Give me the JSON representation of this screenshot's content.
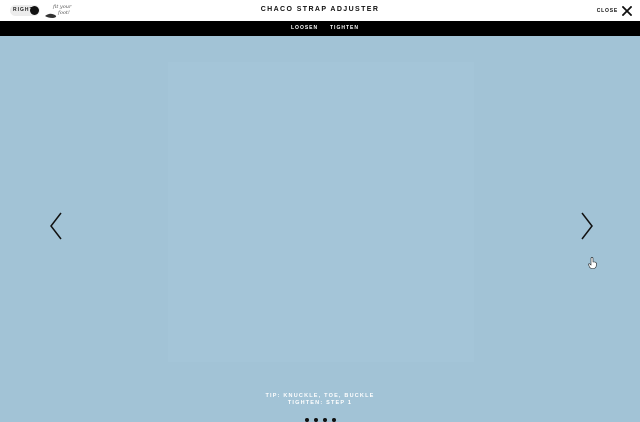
{
  "header": {
    "side_toggle_label": "RIGHT",
    "logo_text_line1": "fit your",
    "logo_text_line2": "foot!",
    "title": "CHACO STRAP ADJUSTER",
    "close_label": "CLOSE"
  },
  "tabs": [
    {
      "label": "LOOSEN",
      "active": false
    },
    {
      "label": "TIGHTEN",
      "active": true
    }
  ],
  "slide": {
    "tip_line1": "TIP: KNUCKLE, TOE, BUCKLE",
    "tip_line2": "TIGHTEN: STEP 1"
  },
  "pagination": {
    "count": 4,
    "current": 1
  },
  "colors": {
    "background": "#a2c3d6",
    "topbar": "#ffffff",
    "tabbar": "#000000",
    "text_light": "#ffffff"
  },
  "icons": {
    "close": "close-icon",
    "prev": "chevron-left-icon",
    "next": "chevron-right-icon",
    "cursor": "hand-cursor-icon"
  }
}
